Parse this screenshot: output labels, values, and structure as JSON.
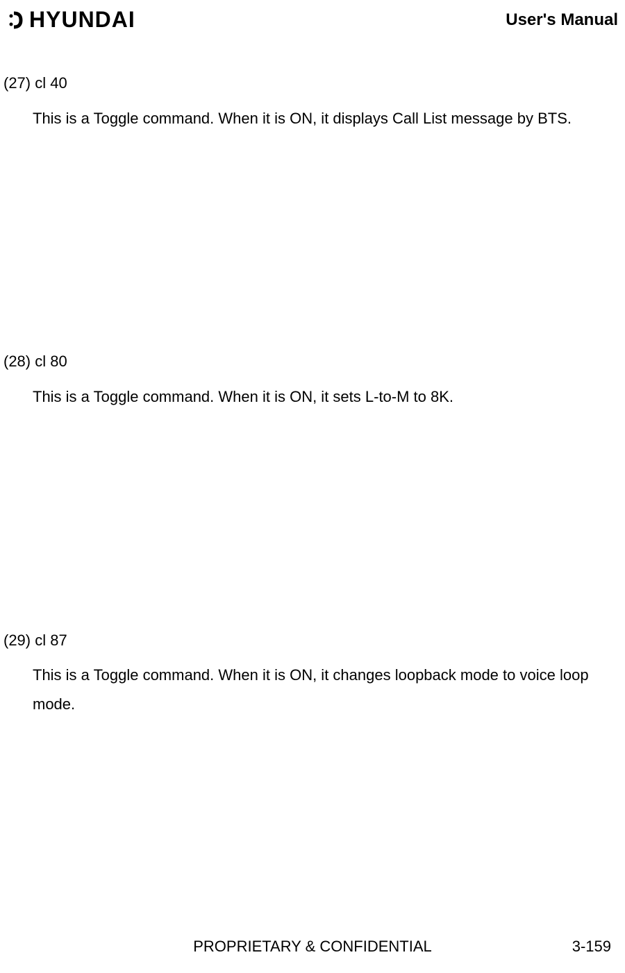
{
  "header": {
    "logo_text": "HYUNDAI",
    "manual_title": "User's Manual"
  },
  "sections": [
    {
      "title": "(27) cl 40",
      "description": "This is a Toggle command. When it is ON, it displays Call List message by BTS."
    },
    {
      "title": "(28) cl 80",
      "description": "This is a Toggle command. When it is ON, it sets L-to-M to 8K."
    },
    {
      "title": "(29) cl 87",
      "description": "This is a Toggle command. When it is ON, it changes loopback mode to voice loop mode."
    }
  ],
  "footer": {
    "center": "PROPRIETARY & CONFIDENTIAL",
    "page": "3-159"
  }
}
